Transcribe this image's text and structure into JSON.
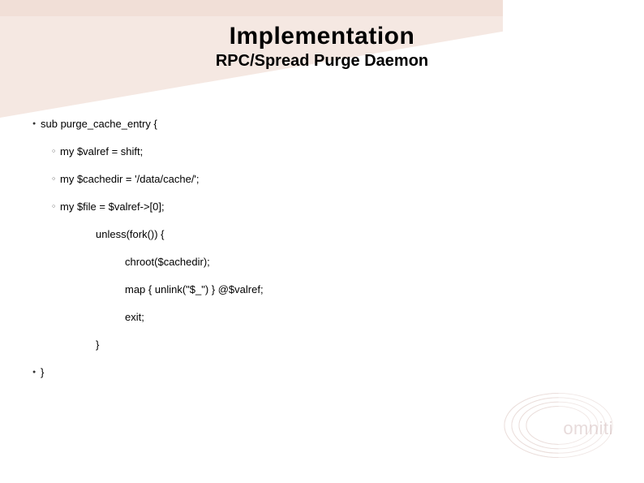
{
  "title": "Implementation",
  "subtitle": "RPC/Spread Purge Daemon",
  "code": {
    "l0": "sub purge_cache_entry {",
    "l1": "my $valref = shift;",
    "l2": "my $cachedir = '/data/cache/';",
    "l3": "my $file = $valref->[0];",
    "l4": "unless(fork()) {",
    "l5": "chroot($cachedir);",
    "l6": "map { unlink(\"$_\") } @$valref;",
    "l7": "exit;",
    "l8": "}",
    "l9": "}"
  },
  "logo_text": "omniti"
}
